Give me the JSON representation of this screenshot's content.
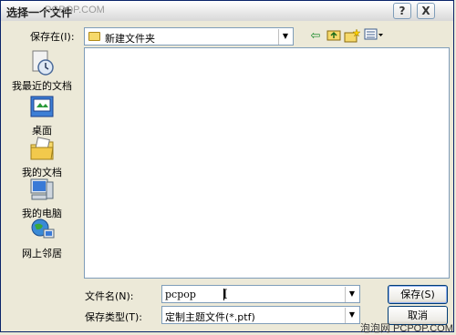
{
  "window": {
    "title": "选择一个文件",
    "top_watermark": "PCPOP.COM",
    "help_glyph": "?",
    "close_glyph": "X"
  },
  "save_in": {
    "label": "保存在(I):",
    "value": "新建文件夹"
  },
  "toolbar": {
    "back_icon": "back-arrow-icon",
    "up_icon": "up-folder-icon",
    "new_folder_icon": "new-folder-icon",
    "view_menu_icon": "view-menu-icon"
  },
  "places": [
    {
      "label": "我最近的文档",
      "icon": "recent-documents-icon"
    },
    {
      "label": "桌面",
      "icon": "desktop-icon"
    },
    {
      "label": "我的文档",
      "icon": "my-documents-icon"
    },
    {
      "label": "我的电脑",
      "icon": "my-computer-icon"
    },
    {
      "label": "网上邻居",
      "icon": "network-places-icon"
    }
  ],
  "file_name": {
    "label": "文件名(N):",
    "value": "pcpop"
  },
  "file_type": {
    "label": "保存类型(T):",
    "value": "定制主题文件(*.ptf)"
  },
  "buttons": {
    "save": "保存(S)",
    "cancel": "取消"
  },
  "bottom_watermark": "泡泡网 PCPOP.COM"
}
